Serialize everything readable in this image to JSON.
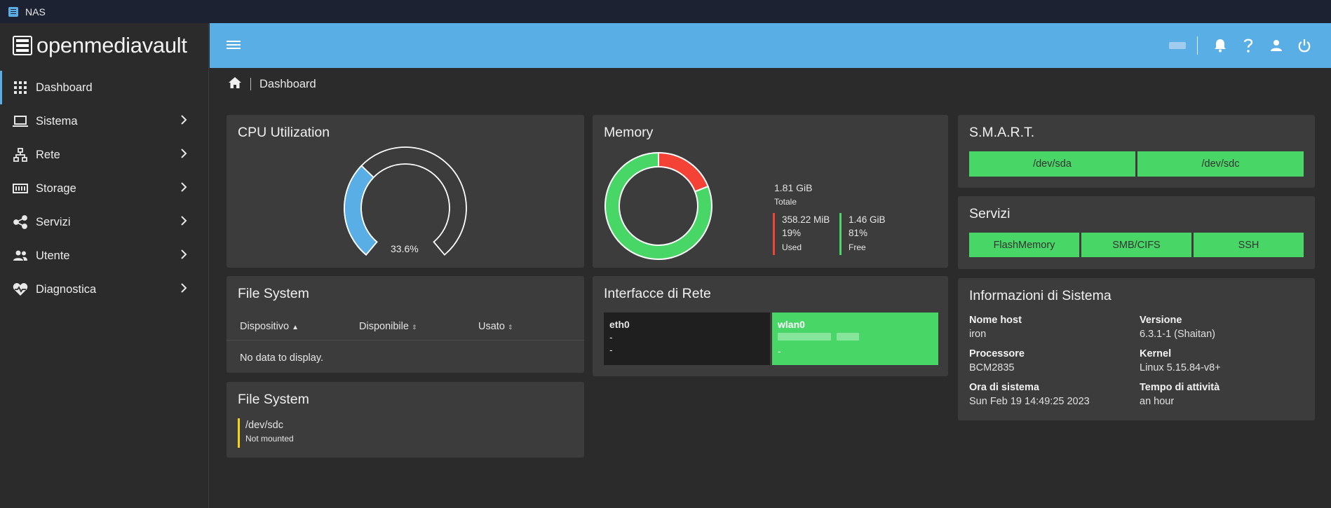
{
  "window": {
    "title": "NAS"
  },
  "brand": {
    "name": "openmediavault"
  },
  "sidebar": {
    "items": [
      {
        "label": "Dashboard",
        "icon": "grid-icon"
      },
      {
        "label": "Sistema",
        "icon": "laptop-icon"
      },
      {
        "label": "Rete",
        "icon": "network-icon"
      },
      {
        "label": "Storage",
        "icon": "storage-icon"
      },
      {
        "label": "Servizi",
        "icon": "share-icon"
      },
      {
        "label": "Utente",
        "icon": "users-icon"
      },
      {
        "label": "Diagnostica",
        "icon": "heart-pulse-icon"
      }
    ]
  },
  "breadcrumb": {
    "current": "Dashboard"
  },
  "cpu": {
    "title": "CPU Utilization",
    "value_label": "33.6%",
    "value": 33.6,
    "colors": {
      "fill": "#5aaee6",
      "track": "#ffffff"
    }
  },
  "memory": {
    "title": "Memory",
    "total": "1.81 GiB",
    "total_label": "Totale",
    "used": {
      "value": "358.22 MiB",
      "percent": "19%",
      "label": "Used",
      "fraction": 0.19,
      "color": "#f44336"
    },
    "free": {
      "value": "1.46 GiB",
      "percent": "81%",
      "label": "Free",
      "fraction": 0.81,
      "color": "#48d666"
    }
  },
  "smart": {
    "title": "S.M.A.R.T.",
    "devices": [
      "/dev/sda",
      "/dev/sdc"
    ]
  },
  "services": {
    "title": "Servizi",
    "items": [
      "FlashMemory",
      "SMB/CIFS",
      "SSH"
    ]
  },
  "filesystem_table": {
    "title": "File System",
    "columns": [
      "Dispositivo",
      "Disponibile",
      "Usato"
    ],
    "empty": "No data to display."
  },
  "filesystem_status": {
    "title": "File System",
    "device": "/dev/sdc",
    "status": "Not mounted",
    "status_color": "#f5d60c"
  },
  "network": {
    "title": "Interfacce di Rete",
    "interfaces": [
      {
        "name": "eth0",
        "line1": "-",
        "line2": "-"
      },
      {
        "name": "wlan0",
        "line2": "-"
      }
    ]
  },
  "sysinfo": {
    "title": "Informazioni di Sistema",
    "fields": [
      {
        "key": "Nome host",
        "value": "iron"
      },
      {
        "key": "Versione",
        "value": "6.3.1-1 (Shaitan)"
      },
      {
        "key": "Processore",
        "value": "BCM2835"
      },
      {
        "key": "Kernel",
        "value": "Linux 5.15.84-v8+"
      },
      {
        "key": "Ora di sistema",
        "value": "Sun Feb 19 14:49:25 2023"
      },
      {
        "key": "Tempo di attività",
        "value": "an hour"
      }
    ]
  },
  "colors": {
    "accent": "#5aaee6",
    "card": "#3c3c3c",
    "background": "#2b2b2b",
    "ok": "#48d666"
  }
}
